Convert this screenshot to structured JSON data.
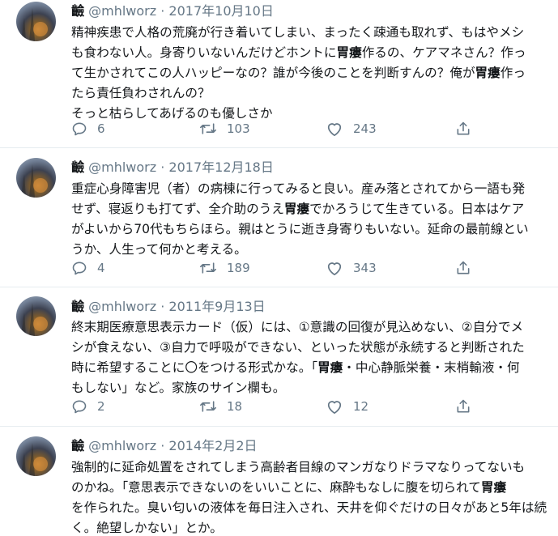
{
  "tweets": [
    {
      "name": "䶨",
      "handle": "@mhlworz",
      "dot": "·",
      "date": "2017年10月10日",
      "lines": [
        [
          {
            "t": "精神疾患で人格の荒廃が行き着いてしまい、まったく疎通も取れず、もはやメシ"
          }
        ],
        [
          {
            "t": "も食わない人。身寄りいないんだけどホントに"
          },
          {
            "t": "胃瘻",
            "b": true
          },
          {
            "t": "作るの、ケアマネさん？作っ"
          }
        ],
        [
          {
            "t": "て生かされてこの人ハッピーなの？誰が今後のことを判断すんの？俺が"
          },
          {
            "t": "胃瘻",
            "b": true
          },
          {
            "t": "作っ"
          }
        ],
        [
          {
            "t": "たら責任負わされんの？"
          }
        ],
        [
          {
            "t": "そっと枯らしてあげるのも優しさか"
          }
        ]
      ],
      "replies": "6",
      "retweets": "103",
      "likes": "243"
    },
    {
      "name": "䶨",
      "handle": "@mhlworz",
      "dot": "·",
      "date": "2017年12月18日",
      "lines": [
        [
          {
            "t": "重症心身障害児（者）の病棟に行ってみると良い。産み落とされてから一語も発"
          }
        ],
        [
          {
            "t": "せず、寝返りも打てず、全介助のうえ"
          },
          {
            "t": "胃瘻",
            "b": true
          },
          {
            "t": "でかろうじて生きている。日本はケア"
          }
        ],
        [
          {
            "t": "がよいから70代もちらほら。親はとうに逝き身寄りもいない。延命の最前線とい"
          }
        ],
        [
          {
            "t": "うか、人生って何かと考える。"
          }
        ]
      ],
      "replies": "4",
      "retweets": "189",
      "likes": "343"
    },
    {
      "name": "䶨",
      "handle": "@mhlworz",
      "dot": "·",
      "date": "2011年9月13日",
      "lines": [
        [
          {
            "t": "終末期医療意思表示カード（仮）には、①意識の回復が見込めない、②自分でメ"
          }
        ],
        [
          {
            "t": "シが食えない、③自力で呼吸ができない、といった状態が永続すると判断された"
          }
        ],
        [
          {
            "t": "時に希望することに〇をつける形式かな。「"
          },
          {
            "t": "胃瘻",
            "b": true
          },
          {
            "t": "・中心静脈栄養・末梢輸液・何"
          }
        ],
        [
          {
            "t": "もしない」など。家族のサイン欄も。"
          }
        ]
      ],
      "replies": "2",
      "retweets": "18",
      "likes": "12"
    },
    {
      "name": "䶨",
      "handle": "@mhlworz",
      "dot": "·",
      "date": "2014年2月2日",
      "lines": [
        [
          {
            "t": "強制的に延命処置をされてしまう高齢者目線のマンガなりドラマなりってないも"
          }
        ],
        [
          {
            "t": "のかね。「意思表示できないのをいいことに、麻酔もなしに腹を切られて"
          },
          {
            "t": "胃瘻",
            "b": true
          }
        ],
        [
          {
            "t": "を作られた。臭い匂いの液体を毎日注入され、天井を仰ぐだけの日々があと5年は続"
          }
        ],
        [
          {
            "t": "く。絶望しかない」とか。"
          }
        ]
      ]
    }
  ],
  "icons": {
    "reply": "reply-icon",
    "retweet": "retweet-icon",
    "like": "like-icon",
    "share": "share-icon"
  },
  "colors": {
    "muted": "#657786",
    "text": "#14171a",
    "divider": "#e6ecf0"
  }
}
